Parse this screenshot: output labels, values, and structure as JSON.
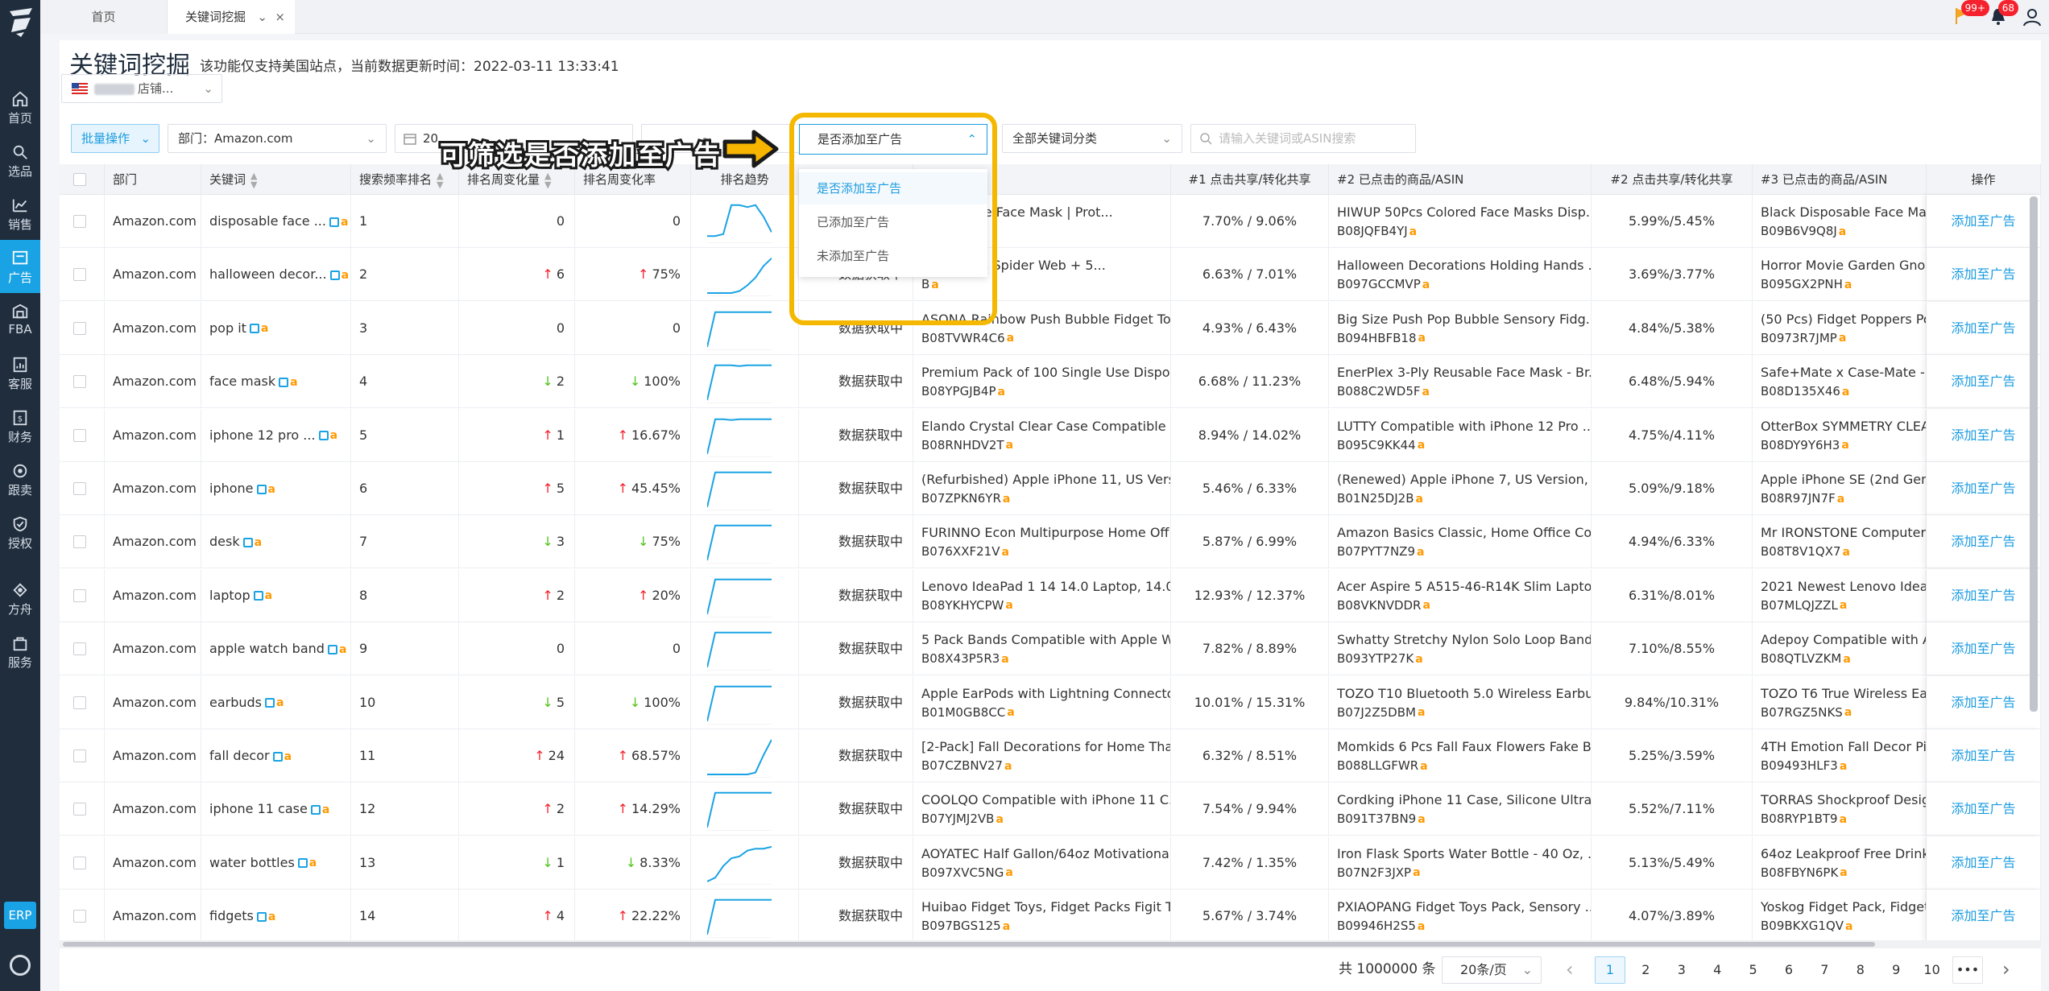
{
  "nav": {
    "items": [
      {
        "label": "首页",
        "icon": "home-icon"
      },
      {
        "label": "选品",
        "icon": "search-icon"
      },
      {
        "label": "销售",
        "icon": "chart-icon"
      },
      {
        "label": "广告",
        "icon": "ad-icon",
        "active": true
      },
      {
        "label": "FBA",
        "icon": "warehouse-icon"
      },
      {
        "label": "客服",
        "icon": "service-icon"
      },
      {
        "label": "财务",
        "icon": "finance-icon"
      },
      {
        "label": "跟卖",
        "icon": "follow-icon"
      },
      {
        "label": "授权",
        "icon": "auth-icon"
      },
      {
        "label": "方舟",
        "icon": "ark-icon"
      },
      {
        "label": "服务",
        "icon": "bag-icon"
      }
    ],
    "erp": "ERP"
  },
  "tabs": {
    "home": "首页",
    "active": "关键词挖掘",
    "close": "×",
    "chevron": "⌄"
  },
  "topbar": {
    "msg_badge": "99+",
    "bell_badge": "68"
  },
  "page": {
    "title": "关键词挖掘",
    "description": "该功能仅支持美国站点，当前数据更新时间：2022-03-11 13:33:41",
    "store_suffix": "店铺..."
  },
  "filters": {
    "batch": "批量操作",
    "department": "部门：Amazon.com",
    "date_start": "20",
    "date_tilde": "~",
    "ad_filter": "是否添加至广告",
    "category": "全部关键词分类",
    "search_placeholder": "请输入关键词或ASIN搜索"
  },
  "annotation": {
    "text": "可筛选是否添加至广告"
  },
  "dropdown": {
    "options": [
      "是否添加至广告",
      "已添加至广告",
      "未添加至广告"
    ]
  },
  "table": {
    "headers": [
      "部门",
      "关键词",
      "搜索频率排名",
      "排名周变化量",
      "排名周变化率",
      "排名趋势",
      "",
      "商品/ASIN",
      "#1 点击共享/转化共享",
      "#2 已点击的商品/ASIN",
      "#2 点击共享/转化共享",
      "#3 已点击的商品/ASIN",
      "操作"
    ],
    "pending": "数据获取中",
    "action": "添加至广告",
    "rows": [
      {
        "dept": "Amazon.com",
        "kw": "disposable face ...",
        "rank": "1",
        "chg": "0",
        "dir": "",
        "rate": "0",
        "p1": "Disposable Face Mask | Prot...",
        "a1": "B3",
        "s1": "7.70% / 9.06%",
        "p2": "HIWUP 50Pcs Colored Face Masks Disp...",
        "a2": "B08JQFB4YJ",
        "s2": "5.99%/5.45%",
        "p3": "Black Disposable Face Masks",
        "a3": "B09B6V9Q8J",
        "trend": [
          0.9,
          0.9,
          0.85,
          0.1,
          0.1,
          0.15,
          0.1,
          0.4,
          0.8
        ]
      },
      {
        "dept": "Amazon.com",
        "kw": "halloween decor...",
        "rank": "2",
        "chg": "6",
        "dir": "up",
        "rate": "75%",
        "p1": "Halloween Spider Web + 5...",
        "a1": "B",
        "s1": "6.63% / 7.01%",
        "p2": "Halloween Decorations Holding Hands ...",
        "a2": "B097GCCMVP",
        "s2": "3.69%/3.77%",
        "p3": "Horror Movie Garden Gnome",
        "a3": "B095GX2PNH",
        "trend": [
          1,
          1,
          1,
          1,
          0.95,
          0.8,
          0.6,
          0.3,
          0.1
        ]
      },
      {
        "dept": "Amazon.com",
        "kw": "pop it",
        "rank": "3",
        "chg": "0",
        "dir": "",
        "rate": "0",
        "p1": "ASONA Rainbow Push Bubble Fidget To...",
        "a1": "B08TVWR4C6",
        "s1": "4.93% / 6.43%",
        "p2": "Big Size Push Pop Bubble Sensory Fidg...",
        "a2": "B094HBFB18",
        "s2": "4.84%/5.38%",
        "p3": "(50 Pcs) Fidget Poppers Popit",
        "a3": "B0973R7JMP",
        "trend": [
          1,
          0.1,
          0.1,
          0.1,
          0.1,
          0.1,
          0.1,
          0.1,
          0.1
        ]
      },
      {
        "dept": "Amazon.com",
        "kw": "face mask",
        "rank": "4",
        "chg": "2",
        "dir": "down",
        "rate": "100%",
        "p1": "Premium Pack of 100 Single Use Dispos...",
        "a1": "B08YPGJB4P",
        "s1": "6.68% / 11.23%",
        "p2": "EnerPlex 3-Ply Reusable Face Mask - Br...",
        "a2": "B088C2WD5F",
        "s2": "6.48%/5.94%",
        "p3": "Safe+Mate x Case-Mate - Clo",
        "a3": "B08D135X46",
        "trend": [
          1,
          0.1,
          0.1,
          0.1,
          0.12,
          0.1,
          0.1,
          0.1,
          0.1
        ]
      },
      {
        "dept": "Amazon.com",
        "kw": "iphone 12 pro ...",
        "rank": "5",
        "chg": "1",
        "dir": "up",
        "rate": "16.67%",
        "p1": "Elando Crystal Clear Case Compatible w...",
        "a1": "B08RNHDV2T",
        "s1": "8.94% / 14.02%",
        "p2": "LUTTY Compatible with iPhone 12 Pro ...",
        "a2": "B095C9KK44",
        "s2": "4.75%/4.11%",
        "p3": "OtterBox SYMMETRY CLEAR",
        "a3": "B08DY9Y6H3",
        "trend": [
          1,
          0.1,
          0.1,
          0.12,
          0.1,
          0.1,
          0.1,
          0.1,
          0.1
        ]
      },
      {
        "dept": "Amazon.com",
        "kw": "iphone",
        "rank": "6",
        "chg": "5",
        "dir": "up",
        "rate": "45.45%",
        "p1": "(Refurbished) Apple iPhone 11, US Versi...",
        "a1": "B07ZPKN6YR",
        "s1": "5.46% / 6.33%",
        "p2": "(Renewed) Apple iPhone 7, US Version, ...",
        "a2": "B01N25DJ2B",
        "s2": "5.09%/9.18%",
        "p3": "Apple iPhone SE (2nd Genera",
        "a3": "B08R97JN7F",
        "trend": [
          1,
          0.1,
          0.1,
          0.1,
          0.1,
          0.1,
          0.1,
          0.1,
          0.1
        ]
      },
      {
        "dept": "Amazon.com",
        "kw": "desk",
        "rank": "7",
        "chg": "3",
        "dir": "down",
        "rate": "75%",
        "p1": "FURINNO Econ Multipurpose Home Off...",
        "a1": "B076XXF21V",
        "s1": "5.87% / 6.99%",
        "p2": "Amazon Basics Classic, Home Office Co...",
        "a2": "B07PYT7NZ9",
        "s2": "4.94%/6.33%",
        "p3": "Mr IRONSTONE Computer De",
        "a3": "B08T8V1QX7",
        "trend": [
          1,
          0.1,
          0.1,
          0.1,
          0.1,
          0.1,
          0.1,
          0.1,
          0.1
        ]
      },
      {
        "dept": "Amazon.com",
        "kw": "laptop",
        "rank": "8",
        "chg": "2",
        "dir": "up",
        "rate": "20%",
        "p1": "Lenovo IdeaPad 1 14 14.0 Laptop, 14.0 ...",
        "a1": "B08YKHYCPW",
        "s1": "12.93% / 12.37%",
        "p2": "Acer Aspire 5 A515-46-R14K Slim Lapto...",
        "a2": "B08VKNVDDR",
        "s2": "6.31%/8.01%",
        "p3": "2021 Newest Lenovo Ideapad",
        "a3": "B07MLQJZZL",
        "trend": [
          1,
          0.1,
          0.1,
          0.1,
          0.1,
          0.1,
          0.1,
          0.1,
          0.1
        ]
      },
      {
        "dept": "Amazon.com",
        "kw": "apple watch band",
        "rank": "9",
        "chg": "0",
        "dir": "",
        "rate": "0",
        "p1": "5 Pack Bands Compatible with Apple W...",
        "a1": "B08X43P5R3",
        "s1": "7.82% / 8.89%",
        "p2": "Swhatty Stretchy Nylon Solo Loop Band...",
        "a2": "B093YTP27K",
        "s2": "7.10%/8.55%",
        "p3": "Adepoy Compatible with App",
        "a3": "B08QTLVZKM",
        "trend": [
          1,
          0.1,
          0.1,
          0.1,
          0.1,
          0.1,
          0.1,
          0.1,
          0.1
        ]
      },
      {
        "dept": "Amazon.com",
        "kw": "earbuds",
        "rank": "10",
        "chg": "5",
        "dir": "down",
        "rate": "100%",
        "p1": "Apple EarPods with Lightning Connecto...",
        "a1": "B01M0GB8CC",
        "s1": "10.01% / 15.31%",
        "p2": "TOZO T10 Bluetooth 5.0 Wireless Earbu...",
        "a2": "B07J2Z5DBM",
        "s2": "9.84%/10.31%",
        "p3": "TOZO T6 True Wireless Earbu",
        "a3": "B07RGZ5NKS",
        "trend": [
          1,
          0.1,
          0.1,
          0.1,
          0.1,
          0.1,
          0.1,
          0.1,
          0.1
        ]
      },
      {
        "dept": "Amazon.com",
        "kw": "fall decor",
        "rank": "11",
        "chg": "24",
        "dir": "up",
        "rate": "68.57%",
        "p1": "[2-Pack] Fall Decorations for Home Tha...",
        "a1": "B07CZBNV27",
        "s1": "6.32% / 8.51%",
        "p2": "Momkids 6 Pcs Fall Faux Flowers Fake B...",
        "a2": "B088LLGFWR",
        "s2": "5.25%/3.59%",
        "p3": "4TH Emotion Fall Decor Pillow",
        "a3": "B09493HLF3",
        "trend": [
          1,
          1,
          1,
          1,
          1,
          1,
          0.95,
          0.5,
          0.1
        ]
      },
      {
        "dept": "Amazon.com",
        "kw": "iphone 11 case",
        "rank": "12",
        "chg": "2",
        "dir": "up",
        "rate": "14.29%",
        "p1": "COOLQO Compatible with iPhone 11 C...",
        "a1": "B07YJMJ2VB",
        "s1": "7.54% / 9.94%",
        "p2": "Cordking iPhone 11 Case, Silicone Ultra...",
        "a2": "B091T37BN9",
        "s2": "5.52%/7.11%",
        "p3": "TORRAS Shockproof Designe",
        "a3": "B08RYP1BT9",
        "trend": [
          1,
          0.1,
          0.1,
          0.1,
          0.1,
          0.1,
          0.1,
          0.1,
          0.1
        ]
      },
      {
        "dept": "Amazon.com",
        "kw": "water bottles",
        "rank": "13",
        "chg": "1",
        "dir": "down",
        "rate": "8.33%",
        "p1": "AOYATEC Half Gallon/64oz Motivational...",
        "a1": "B097XVC5NG",
        "s1": "7.42% / 1.35%",
        "p2": "Iron Flask Sports Water Bottle - 40 Oz, ...",
        "a2": "B07N2F3JXP",
        "s2": "5.13%/5.49%",
        "p3": "64oz Leakproof Free Drinking",
        "a3": "B08FBYN6PK",
        "trend": [
          1,
          0.9,
          0.6,
          0.4,
          0.35,
          0.2,
          0.15,
          0.15,
          0.1
        ]
      },
      {
        "dept": "Amazon.com",
        "kw": "fidgets",
        "rank": "14",
        "chg": "4",
        "dir": "up",
        "rate": "22.22%",
        "p1": "Huibao Fidget Toys, Fidget Packs Figit T...",
        "a1": "B097BGS125",
        "s1": "5.67% / 3.74%",
        "p2": "PXIAOPANG Fidget Toys Pack, Sensory ...",
        "a2": "B09946H2S5",
        "s2": "4.07%/3.89%",
        "p3": "Yoskog Fidget Pack, Fidget To",
        "a3": "B09BKXG1QV",
        "trend": [
          1,
          0.1,
          0.1,
          0.1,
          0.1,
          0.1,
          0.1,
          0.1,
          0.1
        ]
      }
    ]
  },
  "pagination": {
    "total": "共 1000000 条",
    "page_size": "20条/页",
    "prev": "‹",
    "next": "›",
    "ellipsis": "•••",
    "pages": [
      "1",
      "2",
      "3",
      "4",
      "5",
      "6",
      "7",
      "8",
      "9",
      "10"
    ]
  },
  "colors": {
    "accent": "#1a9be0",
    "nav_bg": "#1f2d3d",
    "highlight": "#f5b800",
    "up": "#f5222d",
    "down": "#52c41a"
  }
}
